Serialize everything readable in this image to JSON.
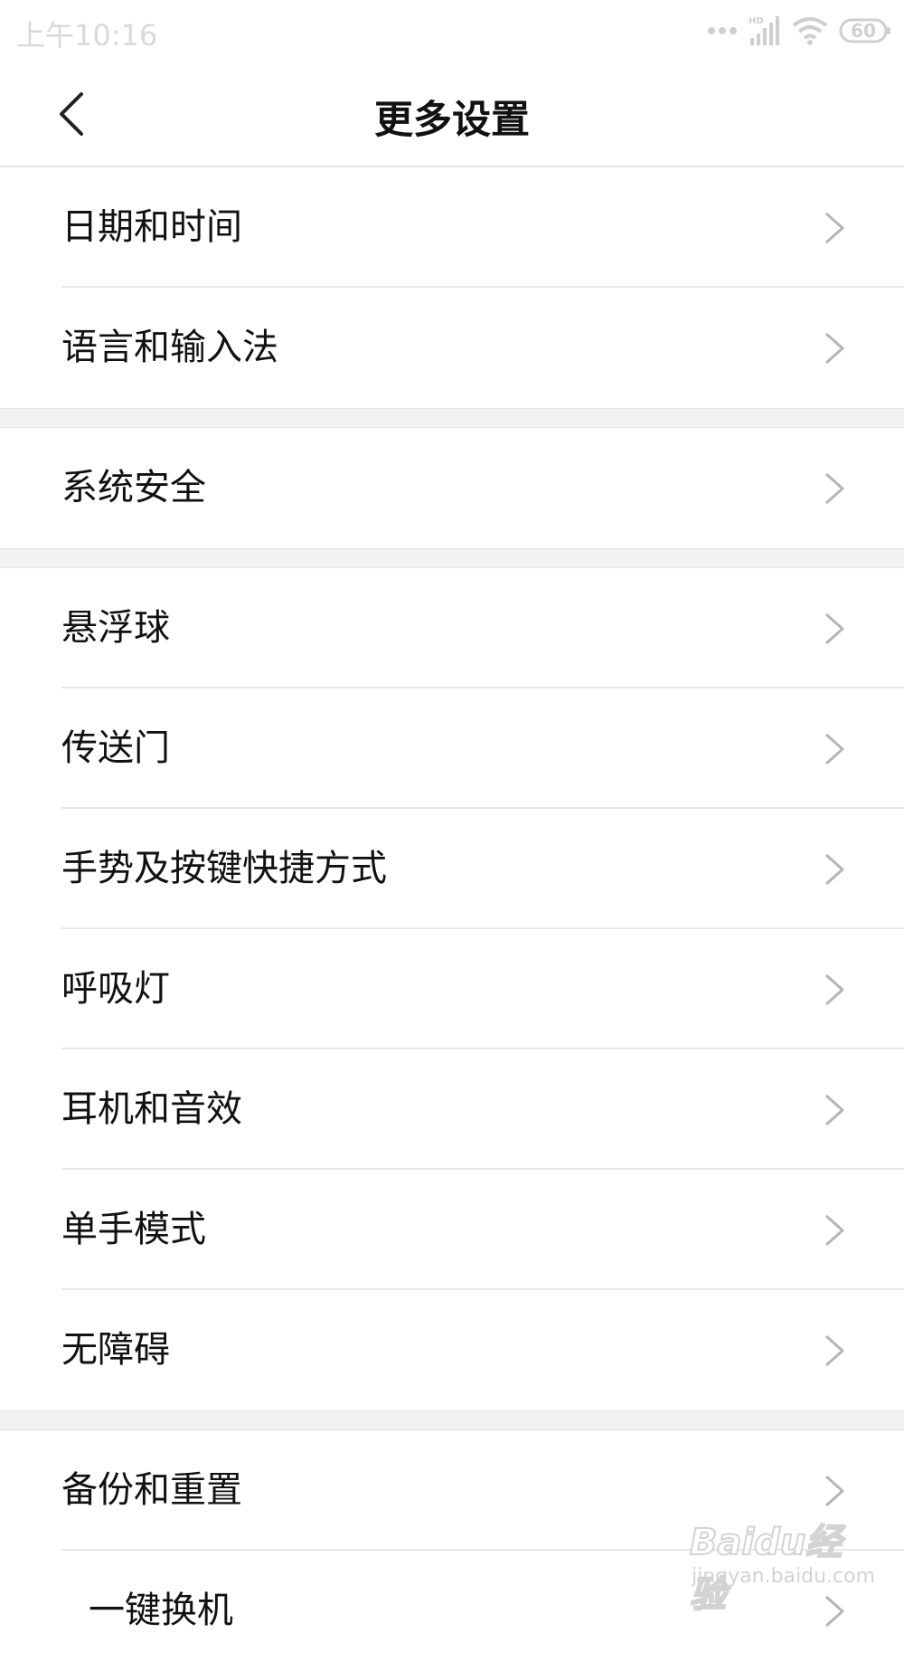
{
  "status_bar": {
    "time": "上午10:16",
    "battery": "60",
    "network_badge": "HD",
    "icons": [
      "dots-icon",
      "signal-icon",
      "wifi-icon",
      "battery-icon"
    ]
  },
  "header": {
    "title": "更多设置",
    "back_icon": "chevron-left-icon"
  },
  "groups": [
    {
      "items": [
        {
          "label": "日期和时间"
        },
        {
          "label": "语言和输入法"
        }
      ]
    },
    {
      "items": [
        {
          "label": "系统安全"
        }
      ]
    },
    {
      "items": [
        {
          "label": "悬浮球"
        },
        {
          "label": "传送门"
        },
        {
          "label": "手势及按键快捷方式"
        },
        {
          "label": "呼吸灯"
        },
        {
          "label": "耳机和音效"
        },
        {
          "label": "单手模式"
        },
        {
          "label": "无障碍"
        }
      ]
    },
    {
      "items": [
        {
          "label": "备份和重置"
        },
        {
          "label": "一键换机"
        }
      ]
    }
  ],
  "watermark": {
    "brand": "Baidu经验",
    "site": "jingyan.baidu.com"
  },
  "colors": {
    "separator": "#f2f2f2",
    "divider": "#e8e8e8",
    "chevron": "#b5b5b5",
    "text": "#111111"
  }
}
